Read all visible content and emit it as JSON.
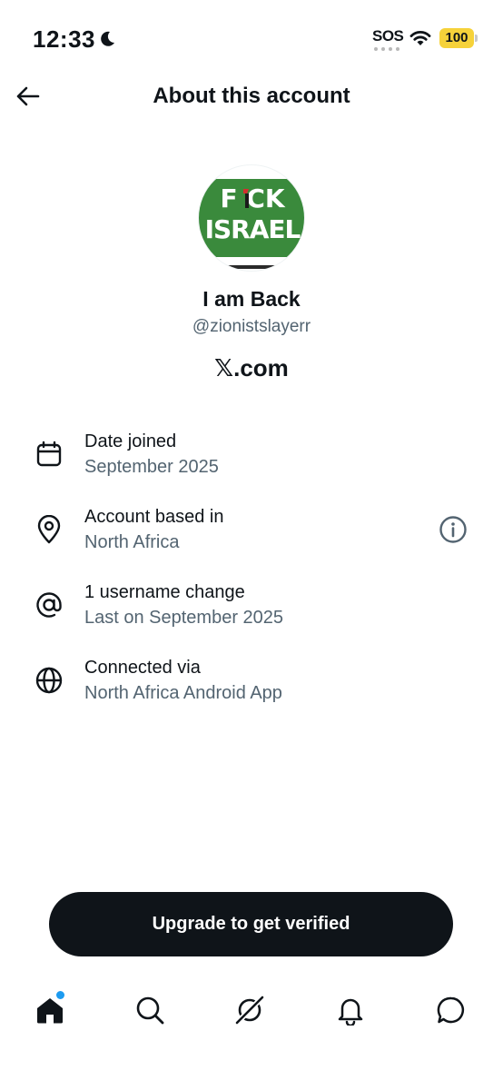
{
  "status_bar": {
    "time": "12:33",
    "sos": "SOS",
    "battery": "100",
    "battery_color": "#f6d23a"
  },
  "header": {
    "title": "About this account"
  },
  "profile": {
    "display_name": "I am Back",
    "handle": "@zionistslayerr",
    "domain": "𝕏.com",
    "avatar_text_line1": "F CK",
    "avatar_text_line2": "ISRAEL",
    "avatar_bg_color": "#3a8a3c"
  },
  "info": [
    {
      "icon": "calendar-icon",
      "label": "Date joined",
      "value": "September 2025"
    },
    {
      "icon": "location-pin-icon",
      "label": "Account based in",
      "value": "North Africa"
    },
    {
      "icon": "at-sign-icon",
      "label": "1 username change",
      "value": "Last on September 2025"
    },
    {
      "icon": "globe-icon",
      "label": "Connected via",
      "value": "North Africa Android App"
    }
  ],
  "upgrade_button": {
    "label": "Upgrade to get verified"
  },
  "tab_bar": {
    "tabs": [
      "home",
      "search",
      "grok",
      "notifications",
      "messages"
    ],
    "notification_dot_color": "#1d9bf0"
  }
}
